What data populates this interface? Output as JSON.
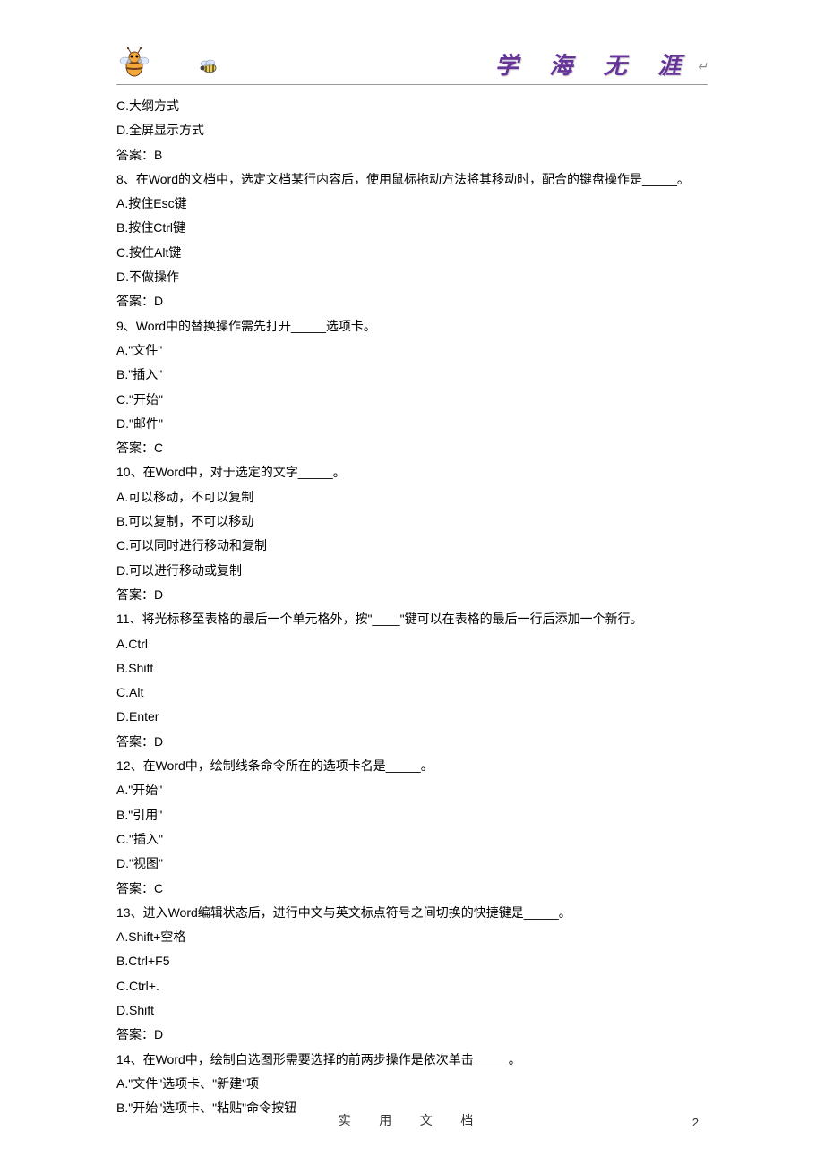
{
  "header": {
    "calligraphy": "学 海 无 涯",
    "return_mark": "↵"
  },
  "footer": {
    "text": "实 用 文 档",
    "page_number": "2"
  },
  "content": {
    "lines": [
      "C.大纲方式",
      "D.全屏显示方式",
      "答案：B",
      "8、在Word的文档中，选定文档某行内容后，使用鼠标拖动方法将其移动时，配合的键盘操作是_____。",
      "A.按住Esc键",
      "B.按住Ctrl键",
      "C.按住Alt键",
      "D.不做操作",
      "答案：D",
      "9、Word中的替换操作需先打开_____选项卡。",
      "A.\"文件\"",
      "B.\"插入\"",
      "C.\"开始\"",
      "D.\"邮件\"",
      "答案：C",
      "10、在Word中，对于选定的文字_____。",
      "A.可以移动，不可以复制",
      "B.可以复制，不可以移动",
      "C.可以同时进行移动和复制",
      "D.可以进行移动或复制",
      "答案：D",
      "11、将光标移至表格的最后一个单元格外，按\"____\"键可以在表格的最后一行后添加一个新行。",
      "A.Ctrl",
      "B.Shift",
      "C.Alt",
      "D.Enter",
      "答案：D",
      "12、在Word中，绘制线条命令所在的选项卡名是_____。",
      "A.\"开始\"",
      "B.\"引用\"",
      "C.\"插入\"",
      "D.\"视图\"",
      "答案：C",
      "13、进入Word编辑状态后，进行中文与英文标点符号之间切换的快捷键是_____。",
      "A.Shift+空格",
      "B.Ctrl+F5",
      "C.Ctrl+.",
      "D.Shift",
      "答案：D",
      "14、在Word中，绘制自选图形需要选择的前两步操作是依次单击_____。",
      "A.\"文件\"选项卡、\"新建\"项",
      "B.\"开始\"选项卡、\"粘贴\"命令按钮"
    ]
  }
}
